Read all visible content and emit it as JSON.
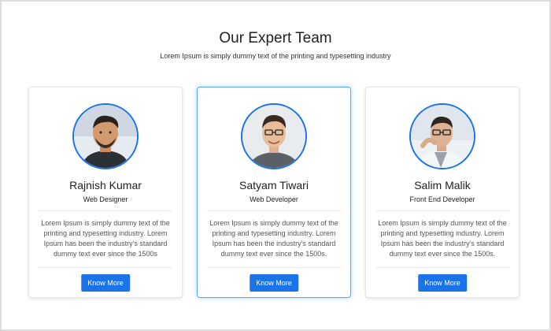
{
  "header": {
    "title": "Our Expert Team",
    "subtitle": "Lorem Ipsum is simply dummy text of the printing and typesetting industry"
  },
  "cards": [
    {
      "name": "Rajnish Kumar",
      "role": "Web Designer",
      "description": "Lorem Ipsum is simply dummy text of the printing and typesetting industry. Lorem Ipsum has been the industry's standard dummy text ever since the 1500s",
      "button": "Know More"
    },
    {
      "name": "Satyam Tiwari",
      "role": "Web Developer",
      "description": "Lorem Ipsum is simply dummy text of the printing and typesetting industry. Lorem Ipsum has been the industry's standard dummy text ever since the 1500s.",
      "button": "Know More"
    },
    {
      "name": "Salim Malik",
      "role": "Front End Developer",
      "description": "Lorem Ipsum is simply dummy text of the printing and typesetting industry. Lorem Ipsum has been the industry's standard dummy text ever since the 1500s.",
      "button": "Know More"
    }
  ],
  "colors": {
    "accent": "#1a73e8",
    "featured_border": "#5aa9f0"
  }
}
